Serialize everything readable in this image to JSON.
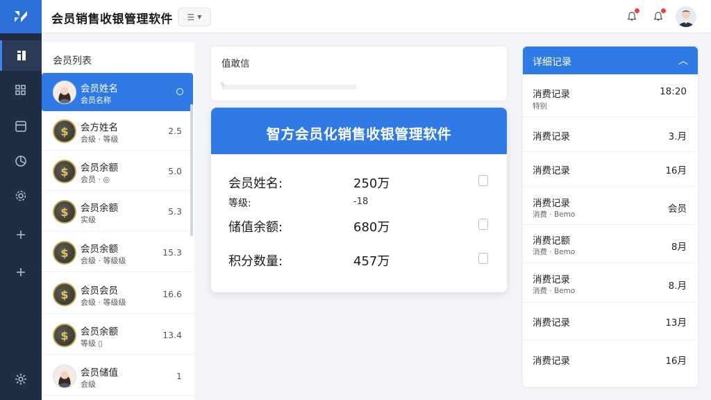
{
  "app": {
    "title": "会员销售收银管理软件",
    "menu_toggle_icon": "menu-icon"
  },
  "colors": {
    "accent": "#2f7ae5",
    "sidebar": "#1f2d45",
    "notification_dot": "#e94040"
  },
  "member_list": {
    "title": "会员列表",
    "members": [
      {
        "name": "会员姓名",
        "sub": "会员名称",
        "value": "",
        "avatar": "person",
        "selected": true
      },
      {
        "name": "会方姓名",
        "sub": "会级 · 等级",
        "value": "2.5",
        "avatar": "coin"
      },
      {
        "name": "会员余额",
        "sub": "会员 · ◎",
        "value": "5.0",
        "avatar": "coin"
      },
      {
        "name": "会员余额",
        "sub": "实级",
        "value": "5.3",
        "avatar": "coin"
      },
      {
        "name": "会员余额",
        "sub": "会级 · 等级级",
        "value": "15.3",
        "avatar": "coin"
      },
      {
        "name": "会员会员",
        "sub": "会级 · 等级级",
        "value": "16.6",
        "avatar": "coin"
      },
      {
        "name": "会员余额",
        "sub": "等级 ▯",
        "value": "13.4",
        "avatar": "coin"
      },
      {
        "name": "会员储值",
        "sub": "会级",
        "value": "1",
        "avatar": "person"
      }
    ]
  },
  "search": {
    "label": "值敢信"
  },
  "detail": {
    "title": "智方会员化销售收银管理软件",
    "fields": [
      {
        "label": "会员姓名:",
        "value": "250万"
      },
      {
        "label": "等级:",
        "value": "-18"
      },
      {
        "label": "储值余额:",
        "value": "680万"
      },
      {
        "label": "积分数量:",
        "value": "457万"
      }
    ]
  },
  "records": {
    "title": "详细记录",
    "items": [
      {
        "label": "消费记录",
        "sub": "特别",
        "value": "18:20"
      },
      {
        "label": "消费记录",
        "sub": "",
        "value": "3.月"
      },
      {
        "label": "消费记录",
        "sub": "",
        "value": "16月"
      },
      {
        "label": "消费记录",
        "sub": "消费 · Bemo",
        "value": "会员"
      },
      {
        "label": "消费记额",
        "sub": "消费 · Bemo",
        "value": "8月"
      },
      {
        "label": "消费记录",
        "sub": "消费 · Bemo",
        "value": "8.月"
      },
      {
        "label": "消费记录",
        "sub": "",
        "value": "13月"
      },
      {
        "label": "消费记录",
        "sub": "",
        "value": "16月"
      }
    ]
  }
}
